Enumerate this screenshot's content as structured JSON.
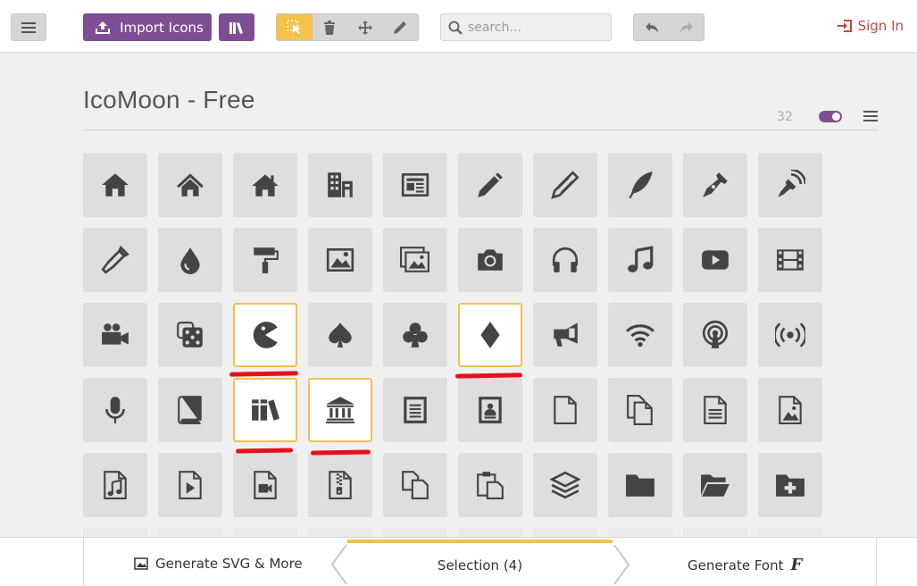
{
  "toolbar": {
    "import_label": "Import Icons",
    "search_placeholder": "search...",
    "sign_in_label": "Sign In",
    "active_tool": "select"
  },
  "set": {
    "title": "IcoMoon - Free",
    "count": "32"
  },
  "colors": {
    "accent_purple": "#7e4e93",
    "accent_yellow": "#f2c14b",
    "sign_in_red": "#c9453a",
    "annotation_red": "#e8101a"
  },
  "icons": [
    {
      "name": "home-icon",
      "selected": false
    },
    {
      "name": "home2-icon",
      "selected": false
    },
    {
      "name": "home3-icon",
      "selected": false
    },
    {
      "name": "office-icon",
      "selected": false
    },
    {
      "name": "newspaper-icon",
      "selected": false
    },
    {
      "name": "pencil-icon",
      "selected": false
    },
    {
      "name": "pencil2-icon",
      "selected": false
    },
    {
      "name": "quill-icon",
      "selected": false
    },
    {
      "name": "pen-icon",
      "selected": false
    },
    {
      "name": "blog-icon",
      "selected": false
    },
    {
      "name": "eyedropper-icon",
      "selected": false
    },
    {
      "name": "droplet-icon",
      "selected": false
    },
    {
      "name": "paint-format-icon",
      "selected": false
    },
    {
      "name": "image-icon",
      "selected": false
    },
    {
      "name": "images-icon",
      "selected": false
    },
    {
      "name": "camera-icon",
      "selected": false
    },
    {
      "name": "headphones-icon",
      "selected": false
    },
    {
      "name": "music-icon",
      "selected": false
    },
    {
      "name": "play-icon",
      "selected": false
    },
    {
      "name": "film-icon",
      "selected": false
    },
    {
      "name": "video-camera-icon",
      "selected": false
    },
    {
      "name": "dice-icon",
      "selected": false
    },
    {
      "name": "pacman-icon",
      "selected": true
    },
    {
      "name": "spades-icon",
      "selected": false
    },
    {
      "name": "clubs-icon",
      "selected": false
    },
    {
      "name": "diamonds-icon",
      "selected": true
    },
    {
      "name": "bullhorn-icon",
      "selected": false
    },
    {
      "name": "connection-icon",
      "selected": false
    },
    {
      "name": "podcast-icon",
      "selected": false
    },
    {
      "name": "feed-icon",
      "selected": false
    },
    {
      "name": "mic-icon",
      "selected": false
    },
    {
      "name": "book-icon",
      "selected": false
    },
    {
      "name": "books-icon",
      "selected": true
    },
    {
      "name": "library-icon",
      "selected": true
    },
    {
      "name": "file-text-icon",
      "selected": false
    },
    {
      "name": "profile-icon",
      "selected": false
    },
    {
      "name": "file-empty-icon",
      "selected": false
    },
    {
      "name": "files-empty-icon",
      "selected": false
    },
    {
      "name": "file-text2-icon",
      "selected": false
    },
    {
      "name": "file-picture-icon",
      "selected": false
    },
    {
      "name": "file-music-icon",
      "selected": false
    },
    {
      "name": "file-play-icon",
      "selected": false
    },
    {
      "name": "file-video-icon",
      "selected": false
    },
    {
      "name": "file-zip-icon",
      "selected": false
    },
    {
      "name": "copy-icon",
      "selected": false
    },
    {
      "name": "paste-icon",
      "selected": false
    },
    {
      "name": "stack-icon",
      "selected": false
    },
    {
      "name": "folder-icon",
      "selected": false
    },
    {
      "name": "folder-open-icon",
      "selected": false
    },
    {
      "name": "folder-plus-icon",
      "selected": false
    }
  ],
  "footer": {
    "generate_svg_label": "Generate SVG & More",
    "selection_label": "Selection (4)",
    "generate_font_label": "Generate Font",
    "font_glyph": "F"
  }
}
